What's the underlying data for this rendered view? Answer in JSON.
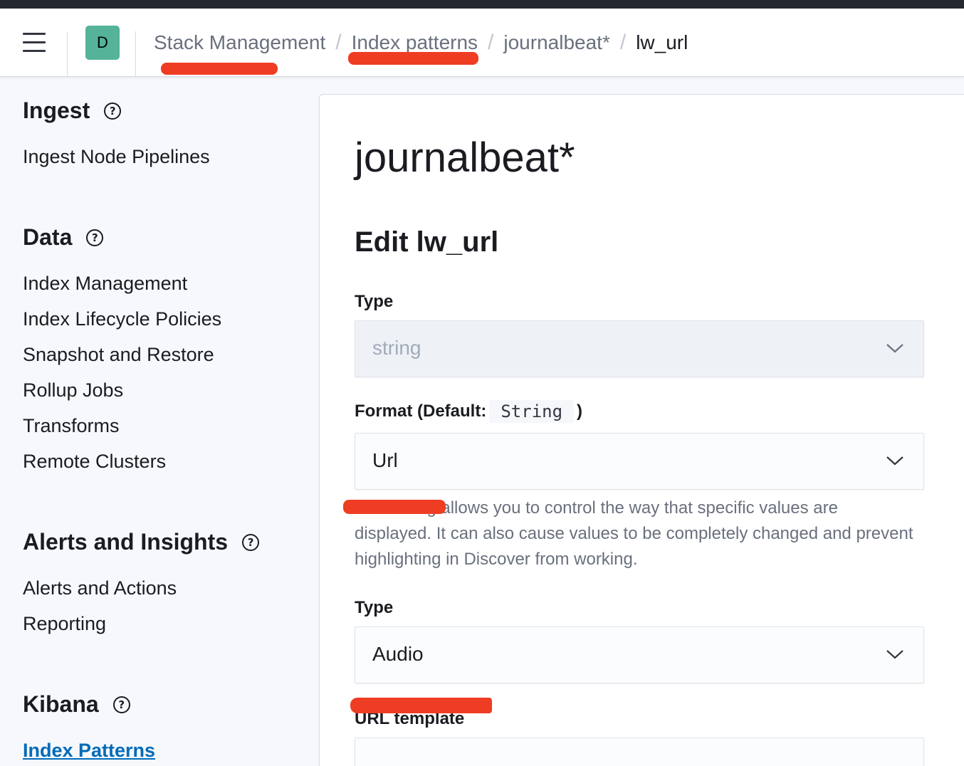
{
  "header": {
    "avatar_letter": "D",
    "breadcrumbs": [
      {
        "label": "Stack Management"
      },
      {
        "label": "Index patterns"
      },
      {
        "label": "journalbeat*"
      },
      {
        "label": "lw_url"
      }
    ],
    "separator": "/"
  },
  "sidebar": {
    "groups": [
      {
        "title": "Ingest",
        "items": [
          "Ingest Node Pipelines"
        ]
      },
      {
        "title": "Data",
        "items": [
          "Index Management",
          "Index Lifecycle Policies",
          "Snapshot and Restore",
          "Rollup Jobs",
          "Transforms",
          "Remote Clusters"
        ]
      },
      {
        "title": "Alerts and Insights",
        "items": [
          "Alerts and Actions",
          "Reporting"
        ]
      },
      {
        "title": "Kibana",
        "items": [
          "Index Patterns"
        ]
      }
    ],
    "active_item": "Index Patterns"
  },
  "main": {
    "title": "journalbeat*",
    "edit_title": "Edit lw_url",
    "type_label": "Type",
    "type_value": "string",
    "format_label_prefix": "Format (Default:",
    "format_default_code": "String",
    "format_label_suffix": ")",
    "format_value": "Url",
    "help_prefix": "Formatting",
    "help_text": " allows you to control the way that specific values are displayed. It can also cause values to be completely changed and prevent highlighting in Discover from working.",
    "url_type_label": "Type",
    "url_type_value": "Audio",
    "url_template_label": "URL template"
  },
  "colors": {
    "accent_link": "#006bb8",
    "avatar": "#54b399",
    "annotation_red": "#ef3d24"
  },
  "icons": {
    "menu": "hamburger-icon",
    "help": "question-circle-icon",
    "dropdown": "chevron-down-icon"
  }
}
